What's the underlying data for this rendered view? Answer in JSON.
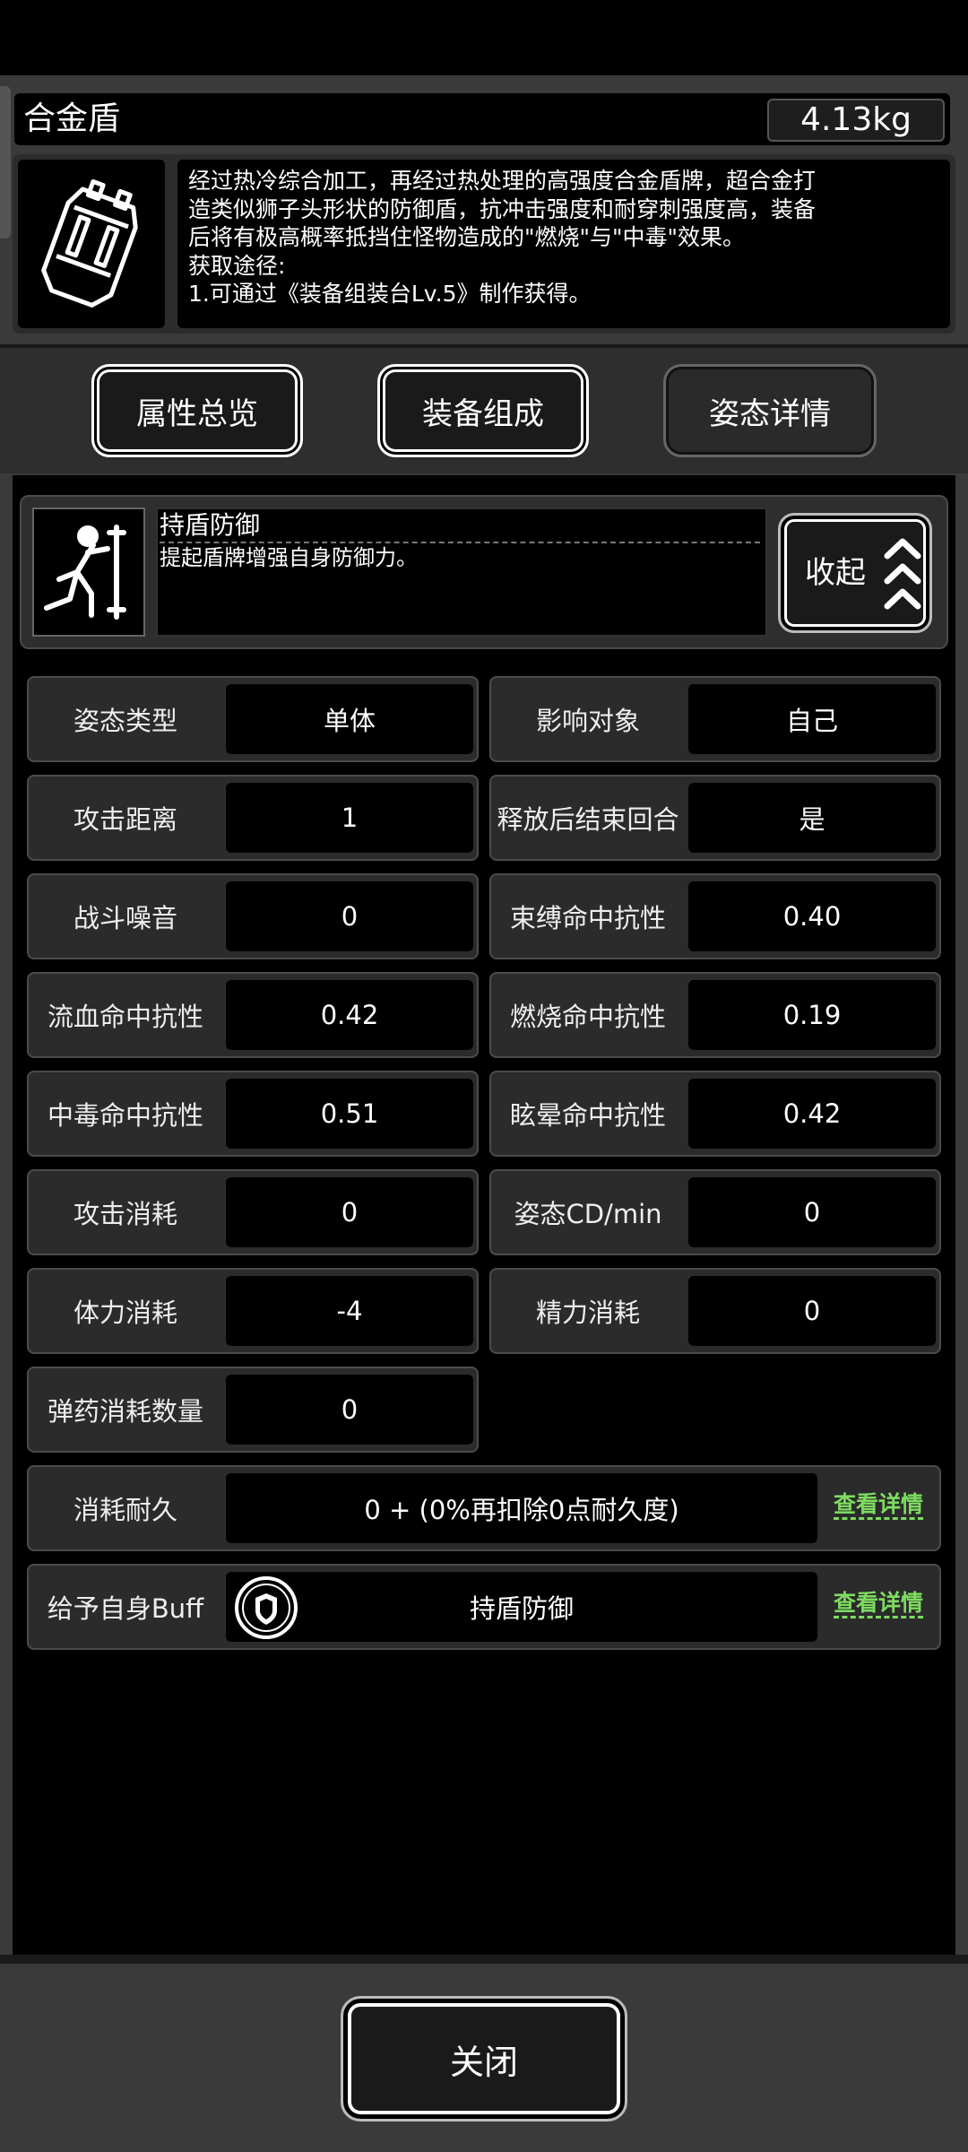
{
  "item": {
    "name": "合金盾",
    "weight": "4.13kg",
    "description_lines": [
      "经过热冷综合加工，再经过热处理的高强度合金盾牌，超合金打",
      "造类似狮子头形状的防御盾，抗冲击强度和耐穿刺强度高，装备",
      "后将有极高概率抵挡住怪物造成的\"燃烧\"与\"中毒\"效果。",
      "获取途径:",
      "1.可通过《装备组装台Lv.5》制作获得。"
    ]
  },
  "tabs": [
    {
      "label": "属性总览"
    },
    {
      "label": "装备组成"
    },
    {
      "label": "姿态详情"
    }
  ],
  "stance": {
    "name": "持盾防御",
    "description": "提起盾牌增强自身防御力。",
    "collapse_label": "收起"
  },
  "stats": [
    {
      "label": "姿态类型",
      "value": "单体"
    },
    {
      "label": "影响对象",
      "value": "自己"
    },
    {
      "label": "攻击距离",
      "value": "1"
    },
    {
      "label": "释放后结束回合",
      "value": "是"
    },
    {
      "label": "战斗噪音",
      "value": "0"
    },
    {
      "label": "束缚命中抗性",
      "value": "0.40"
    },
    {
      "label": "流血命中抗性",
      "value": "0.42"
    },
    {
      "label": "燃烧命中抗性",
      "value": "0.19"
    },
    {
      "label": "中毒命中抗性",
      "value": "0.51"
    },
    {
      "label": "眩晕命中抗性",
      "value": "0.42"
    },
    {
      "label": "攻击消耗",
      "value": "0"
    },
    {
      "label": "姿态CD/min",
      "value": "0"
    },
    {
      "label": "体力消耗",
      "value": "-4"
    },
    {
      "label": "精力消耗",
      "value": "0"
    },
    {
      "label": "弹药消耗数量",
      "value": "0"
    }
  ],
  "durability": {
    "label": "消耗耐久",
    "value": "0 + (0%再扣除0点耐久度)",
    "link": "查看详情"
  },
  "buff": {
    "label": "给予自身Buff",
    "value": "持盾防御",
    "link": "查看详情"
  },
  "close_label": "关闭"
}
